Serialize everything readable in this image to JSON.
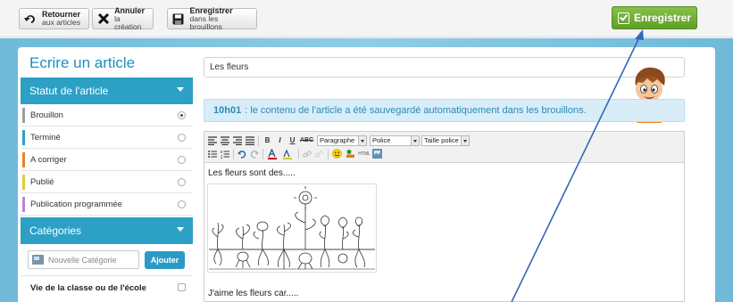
{
  "toolbar": {
    "back": {
      "line1": "Retourner",
      "line2": "aux articles"
    },
    "cancel": {
      "line1": "Annuler",
      "line2": "la création"
    },
    "draft": {
      "line1": "Enregistrer",
      "line2": "dans les brouillons"
    },
    "save_label": "Enregistrer"
  },
  "page": {
    "title": "Ecrire un article"
  },
  "status_section": {
    "title": "Statut de l'article",
    "items": [
      {
        "label": "Brouillon",
        "color": "#9e9e9e",
        "selected": true
      },
      {
        "label": "Terminé",
        "color": "#2da0c6",
        "selected": false
      },
      {
        "label": "A corriger",
        "color": "#e8842b",
        "selected": false
      },
      {
        "label": "Publié",
        "color": "#d7d23a",
        "selected": false
      },
      {
        "label": "Publication programmée",
        "color": "#b48ad6",
        "selected": false
      }
    ]
  },
  "categories_section": {
    "title": "Catégories",
    "new_placeholder": "Nouvelle Catégorie",
    "add_label": "Ajouter",
    "items": [
      {
        "label": "Vie de la classe ou de l'école",
        "checked": false
      }
    ]
  },
  "article": {
    "title_value": "Les fleurs"
  },
  "notice": {
    "time": "10h01",
    "message": ": le contenu de l'article a été sauvegardé automatiquement dans les brouillons."
  },
  "editor": {
    "format_select": "Paragraphe",
    "font_select": "Police",
    "size_select": "Taille police",
    "line1": "Les fleurs sont des.....",
    "line2": "J'aime les fleurs car....."
  },
  "colors": {
    "accent": "#2da0c6",
    "save": "#6aab2f",
    "background": "#7fc4e0"
  }
}
